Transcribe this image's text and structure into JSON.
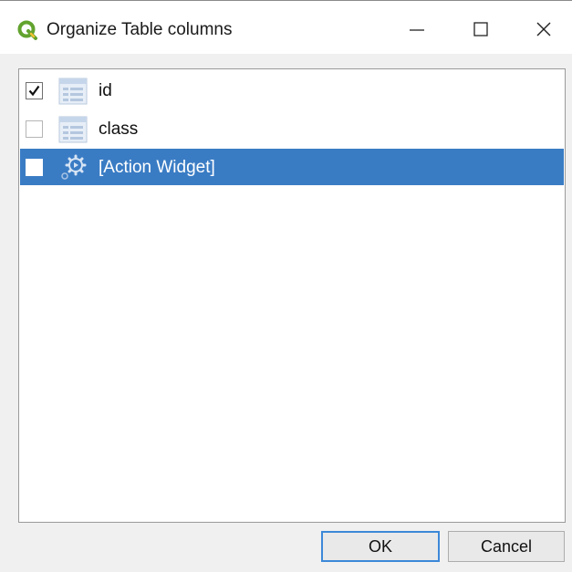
{
  "window": {
    "title": "Organize Table columns",
    "app_icon": "qgis-logo-icon",
    "controls": [
      "minimize-icon",
      "maximize-icon",
      "close-icon"
    ]
  },
  "columns": [
    {
      "label": "id",
      "checked": true,
      "icon": "table-field-icon",
      "selected": false
    },
    {
      "label": "class",
      "checked": false,
      "icon": "table-field-icon",
      "selected": false
    },
    {
      "label": "[Action Widget]",
      "checked": false,
      "icon": "action-gear-icon",
      "selected": true
    }
  ],
  "buttons": {
    "ok": "OK",
    "cancel": "Cancel"
  },
  "colors": {
    "selection": "#3a7cc4",
    "qgis_green": "#62a32e",
    "qgis_yellow": "#f2c230",
    "default_button_border": "#3c88d8"
  }
}
